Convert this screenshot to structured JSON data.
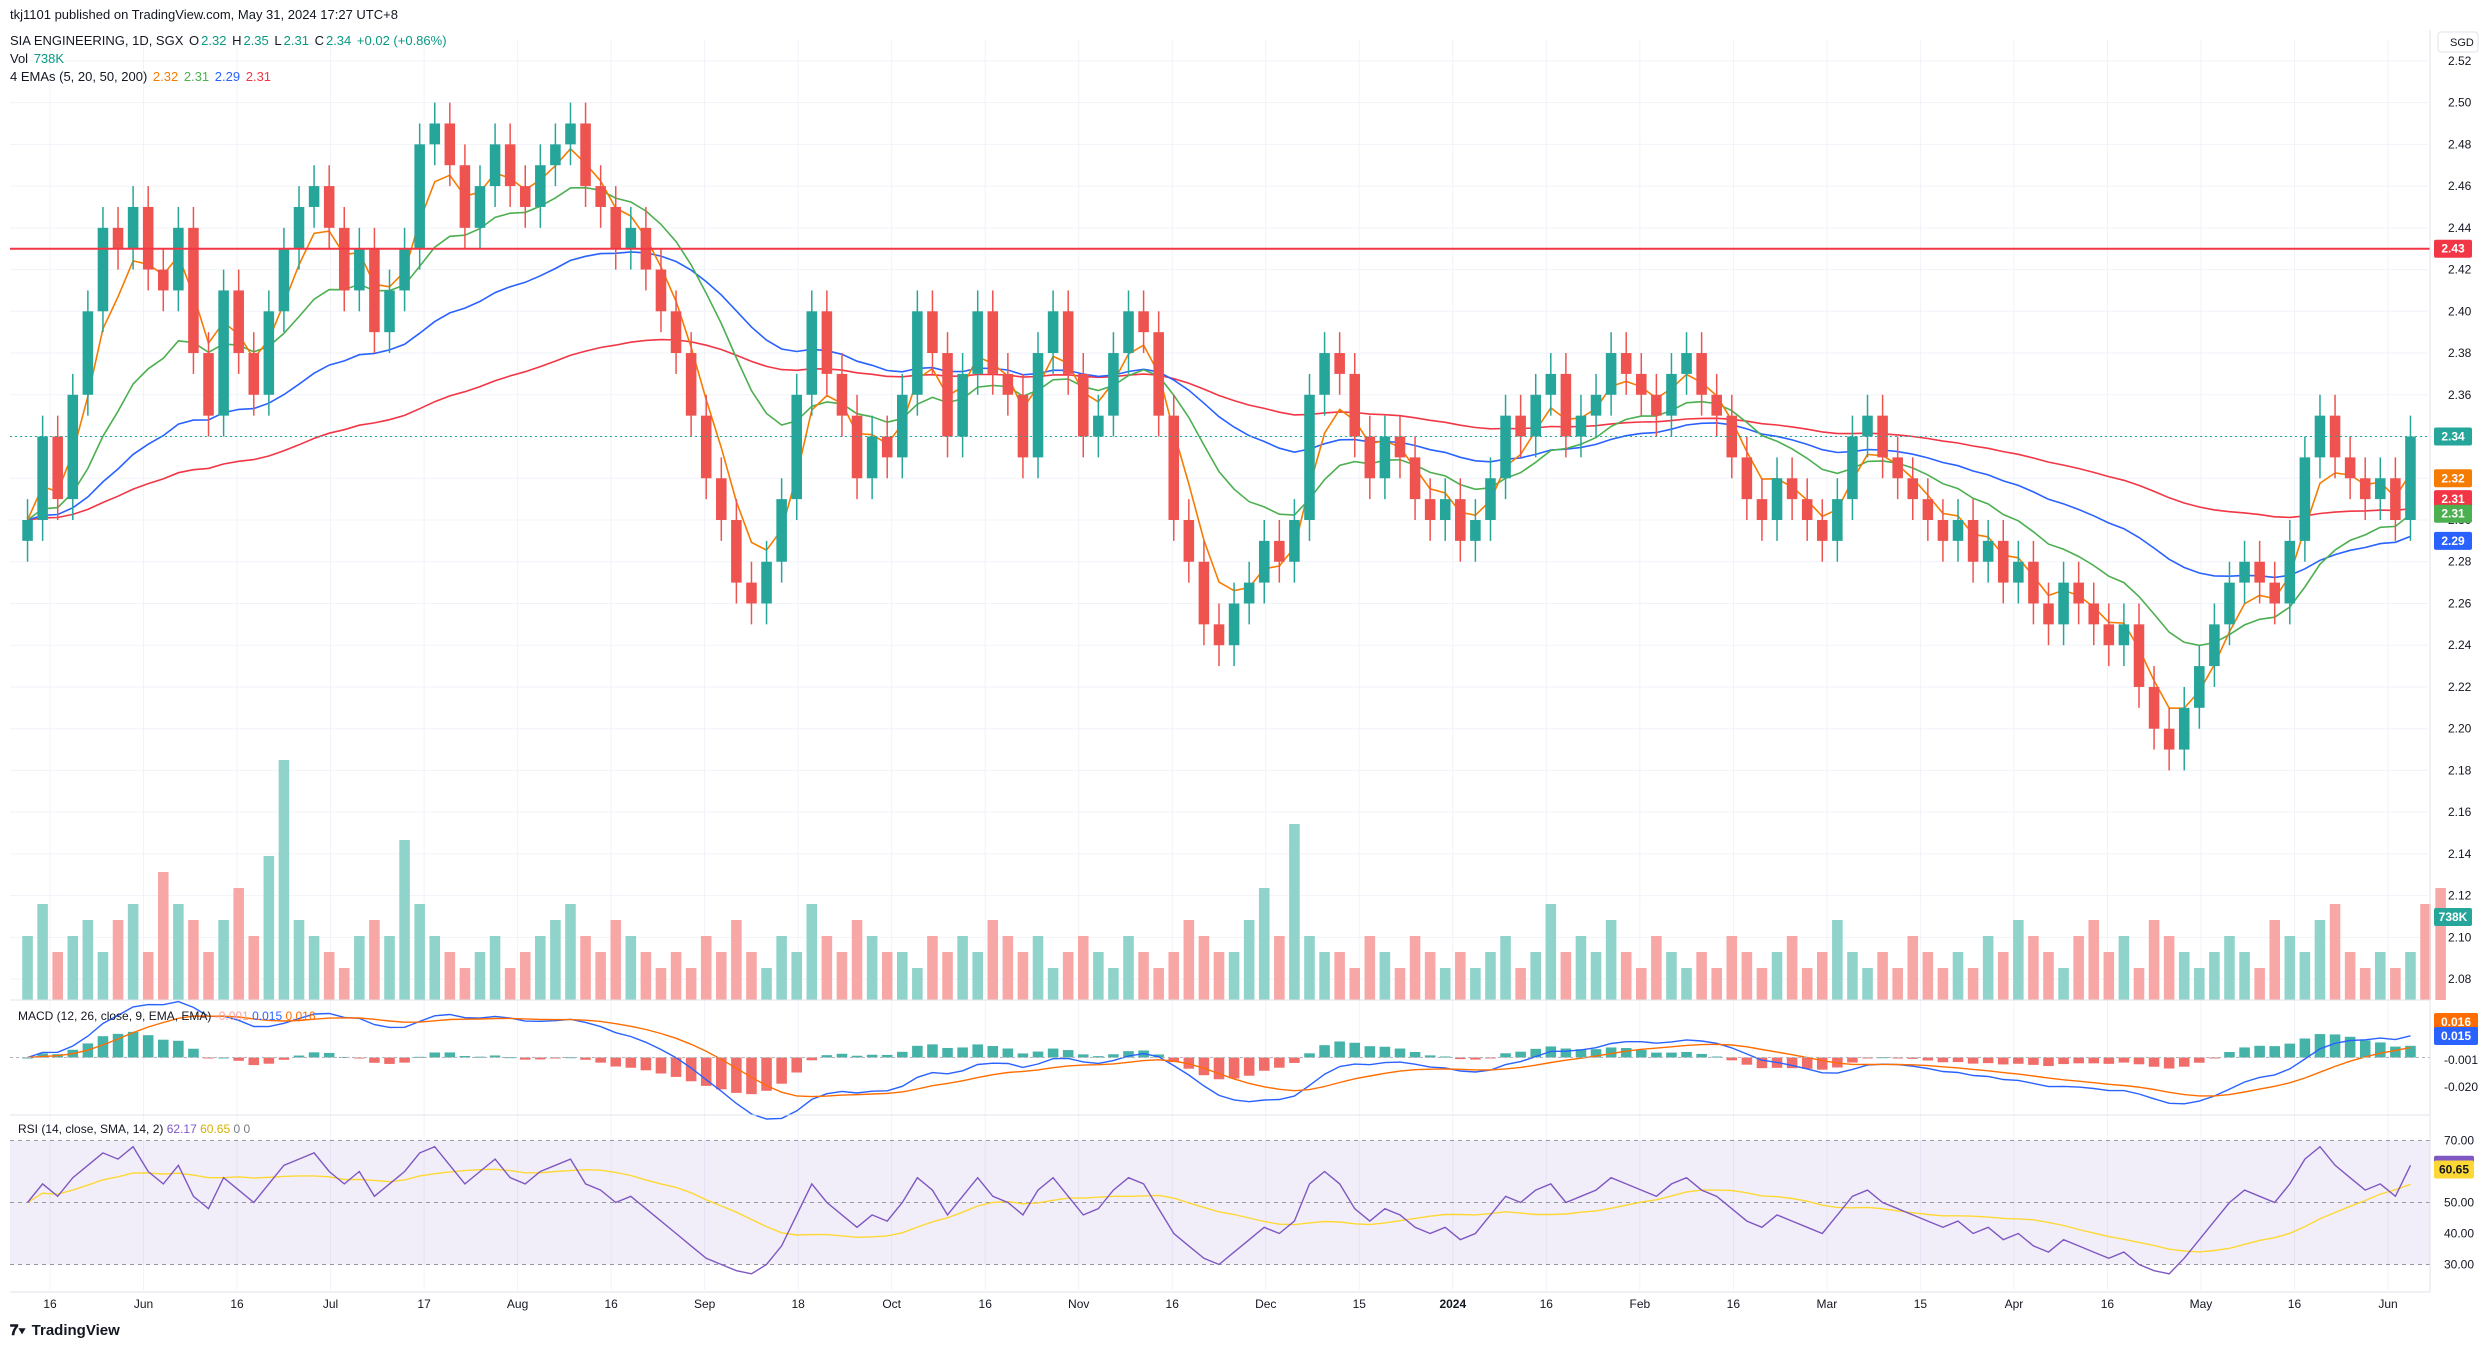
{
  "header": {
    "publisher": "tkj1101 published on TradingView.com, May 31, 2024 17:27 UTC+8",
    "symbol": "SIA ENGINEERING, 1D, SGX",
    "o_label": "O",
    "o": "2.32",
    "h_label": "H",
    "h": "2.35",
    "l_label": "L",
    "l": "2.31",
    "c_label": "C",
    "c": "2.34",
    "change": "+0.02 (+0.86%)",
    "vol_label": "Vol",
    "vol": "738K",
    "ema_label": "4 EMAs (5, 20, 50, 200)",
    "ema_values": [
      "2.32",
      "2.31",
      "2.29",
      "2.31"
    ]
  },
  "currency": "SGD",
  "indicators": {
    "macd_label": "MACD (12, 26, close, 9, EMA, EMA)",
    "macd_values": [
      "-0.001",
      "0.015",
      "0.016"
    ],
    "rsi_label": "RSI (14, close, SMA, 14, 2)",
    "rsi_values": [
      "62.17",
      "60.65",
      "0",
      "0"
    ]
  },
  "brand": "TradingView",
  "colors": {
    "up": "#26a69a",
    "down": "#ef5350",
    "ema5": "#f57c00",
    "ema20": "#4caf50",
    "ema50": "#2962ff",
    "ema200": "#f23645",
    "hline": "#f23645",
    "macd": "#2962ff",
    "signal": "#ff6d00",
    "rsi": "#7e57c2",
    "rsi_ma": "#fdd835"
  },
  "chart_data": [
    {
      "type": "candlestick",
      "y_ticks": [
        "2.52",
        "2.50",
        "2.48",
        "2.46",
        "2.44",
        "2.42",
        "2.40",
        "2.38",
        "2.36",
        "2.34",
        "2.32",
        "2.30",
        "2.28",
        "2.26",
        "2.24",
        "2.22",
        "2.20",
        "2.18",
        "2.16",
        "2.14",
        "2.12",
        "2.10",
        "2.08"
      ],
      "ylim": [
        2.07,
        2.53
      ],
      "x_ticks": [
        "16",
        "Jun",
        "16",
        "Jul",
        "17",
        "Aug",
        "16",
        "Sep",
        "18",
        "Oct",
        "16",
        "Nov",
        "16",
        "Dec",
        "15",
        "2024",
        "16",
        "Feb",
        "16",
        "Mar",
        "15",
        "Apr",
        "16",
        "May",
        "16",
        "Jun"
      ],
      "horizontal_line": 2.43,
      "last_price": 2.34,
      "price_labels": {
        "hline": "2.43",
        "last": "2.34",
        "ema5": "2.32",
        "ema200": "2.31",
        "ema20": "2.31",
        "ema50": "2.29",
        "volume": "738K"
      },
      "close": [
        2.3,
        2.34,
        2.31,
        2.36,
        2.4,
        2.44,
        2.43,
        2.45,
        2.42,
        2.41,
        2.44,
        2.38,
        2.35,
        2.41,
        2.38,
        2.36,
        2.4,
        2.43,
        2.45,
        2.46,
        2.44,
        2.41,
        2.43,
        2.39,
        2.41,
        2.43,
        2.48,
        2.49,
        2.47,
        2.44,
        2.46,
        2.48,
        2.46,
        2.45,
        2.47,
        2.48,
        2.49,
        2.46,
        2.45,
        2.43,
        2.44,
        2.42,
        2.4,
        2.38,
        2.35,
        2.32,
        2.3,
        2.27,
        2.26,
        2.28,
        2.31,
        2.36,
        2.4,
        2.37,
        2.35,
        2.32,
        2.34,
        2.33,
        2.36,
        2.4,
        2.38,
        2.34,
        2.37,
        2.4,
        2.37,
        2.36,
        2.33,
        2.38,
        2.4,
        2.37,
        2.34,
        2.35,
        2.38,
        2.4,
        2.39,
        2.35,
        2.3,
        2.28,
        2.25,
        2.24,
        2.26,
        2.27,
        2.29,
        2.28,
        2.3,
        2.36,
        2.38,
        2.37,
        2.34,
        2.32,
        2.34,
        2.33,
        2.31,
        2.3,
        2.31,
        2.29,
        2.3,
        2.32,
        2.35,
        2.34,
        2.36,
        2.37,
        2.34,
        2.35,
        2.36,
        2.38,
        2.37,
        2.36,
        2.35,
        2.37,
        2.38,
        2.36,
        2.35,
        2.33,
        2.31,
        2.3,
        2.32,
        2.31,
        2.3,
        2.29,
        2.31,
        2.34,
        2.35,
        2.33,
        2.32,
        2.31,
        2.3,
        2.29,
        2.3,
        2.28,
        2.29,
        2.27,
        2.28,
        2.26,
        2.25,
        2.27,
        2.26,
        2.25,
        2.24,
        2.25,
        2.22,
        2.2,
        2.19,
        2.21,
        2.23,
        2.25,
        2.27,
        2.28,
        2.27,
        2.26,
        2.29,
        2.33,
        2.35,
        2.33,
        2.32,
        2.31,
        2.32,
        2.3,
        2.34
      ]
    },
    {
      "type": "bar",
      "name": "Volume",
      "values": [
        0.4,
        0.6,
        0.3,
        0.4,
        0.5,
        0.3,
        0.5,
        0.6,
        0.3,
        0.8,
        0.6,
        0.5,
        0.3,
        0.5,
        0.7,
        0.4,
        0.9,
        1.5,
        0.5,
        0.4,
        0.3,
        0.2,
        0.4,
        0.5,
        0.4,
        1.0,
        0.6,
        0.4,
        0.3,
        0.2,
        0.3,
        0.4,
        0.2,
        0.3,
        0.4,
        0.5,
        0.6,
        0.4,
        0.3,
        0.5,
        0.4,
        0.3,
        0.2,
        0.3,
        0.2,
        0.4,
        0.3,
        0.5,
        0.3,
        0.2,
        0.4,
        0.3,
        0.6,
        0.4,
        0.3,
        0.5,
        0.4,
        0.3,
        0.3,
        0.2,
        0.4,
        0.3,
        0.4,
        0.3,
        0.5,
        0.4,
        0.3,
        0.4,
        0.2,
        0.3,
        0.4,
        0.3,
        0.2,
        0.4,
        0.3,
        0.2,
        0.3,
        0.5,
        0.4,
        0.3,
        0.3,
        0.5,
        0.7,
        0.4,
        1.1,
        0.4,
        0.3,
        0.3,
        0.2,
        0.4,
        0.3,
        0.2,
        0.4,
        0.3,
        0.2,
        0.3,
        0.2,
        0.3,
        0.4,
        0.2,
        0.3,
        0.6,
        0.3,
        0.4,
        0.3,
        0.5,
        0.3,
        0.2,
        0.4,
        0.3,
        0.2,
        0.3,
        0.2,
        0.4,
        0.3,
        0.2,
        0.3,
        0.4,
        0.2,
        0.3,
        0.5,
        0.3,
        0.2,
        0.3,
        0.2,
        0.4,
        0.3,
        0.2,
        0.3,
        0.2,
        0.4,
        0.3,
        0.5,
        0.4,
        0.3,
        0.2,
        0.4,
        0.5,
        0.3,
        0.4,
        0.2,
        0.5,
        0.4,
        0.3,
        0.2,
        0.3,
        0.4,
        0.3,
        0.2,
        0.5,
        0.4,
        0.3,
        0.5,
        0.6,
        0.3,
        0.2,
        0.3,
        0.2,
        0.3,
        0.6,
        0.7
      ]
    },
    {
      "type": "line",
      "name": "MACD",
      "y_ticks": [
        "0.016",
        "0.015",
        "-0.001",
        "-0.020"
      ],
      "ylim": [
        -0.03,
        0.03
      ]
    },
    {
      "type": "line",
      "name": "RSI",
      "y_ticks": [
        "70.00",
        "62.17",
        "60.65",
        "50.00",
        "40.00",
        "30.00"
      ],
      "ylim": [
        25,
        75
      ],
      "bands": [
        30,
        70
      ],
      "values": [
        50,
        56,
        52,
        58,
        62,
        66,
        64,
        68,
        60,
        56,
        62,
        52,
        48,
        58,
        54,
        50,
        56,
        62,
        64,
        66,
        60,
        56,
        60,
        52,
        56,
        60,
        66,
        68,
        62,
        56,
        60,
        64,
        58,
        56,
        60,
        62,
        64,
        56,
        54,
        50,
        52,
        48,
        44,
        40,
        36,
        32,
        30,
        28,
        27,
        30,
        36,
        46,
        56,
        50,
        46,
        42,
        46,
        44,
        50,
        58,
        54,
        46,
        52,
        58,
        52,
        50,
        46,
        54,
        58,
        52,
        46,
        48,
        54,
        58,
        56,
        48,
        40,
        36,
        32,
        30,
        34,
        38,
        42,
        40,
        44,
        56,
        60,
        56,
        48,
        44,
        48,
        46,
        42,
        40,
        42,
        38,
        40,
        46,
        52,
        50,
        54,
        56,
        50,
        52,
        54,
        58,
        56,
        54,
        52,
        56,
        58,
        54,
        52,
        48,
        44,
        42,
        46,
        44,
        42,
        40,
        46,
        52,
        54,
        50,
        48,
        46,
        44,
        42,
        44,
        40,
        42,
        38,
        40,
        36,
        34,
        38,
        36,
        34,
        32,
        34,
        30,
        28,
        27,
        32,
        38,
        44,
        50,
        54,
        52,
        50,
        56,
        64,
        68,
        62,
        58,
        54,
        56,
        52,
        62
      ]
    }
  ]
}
